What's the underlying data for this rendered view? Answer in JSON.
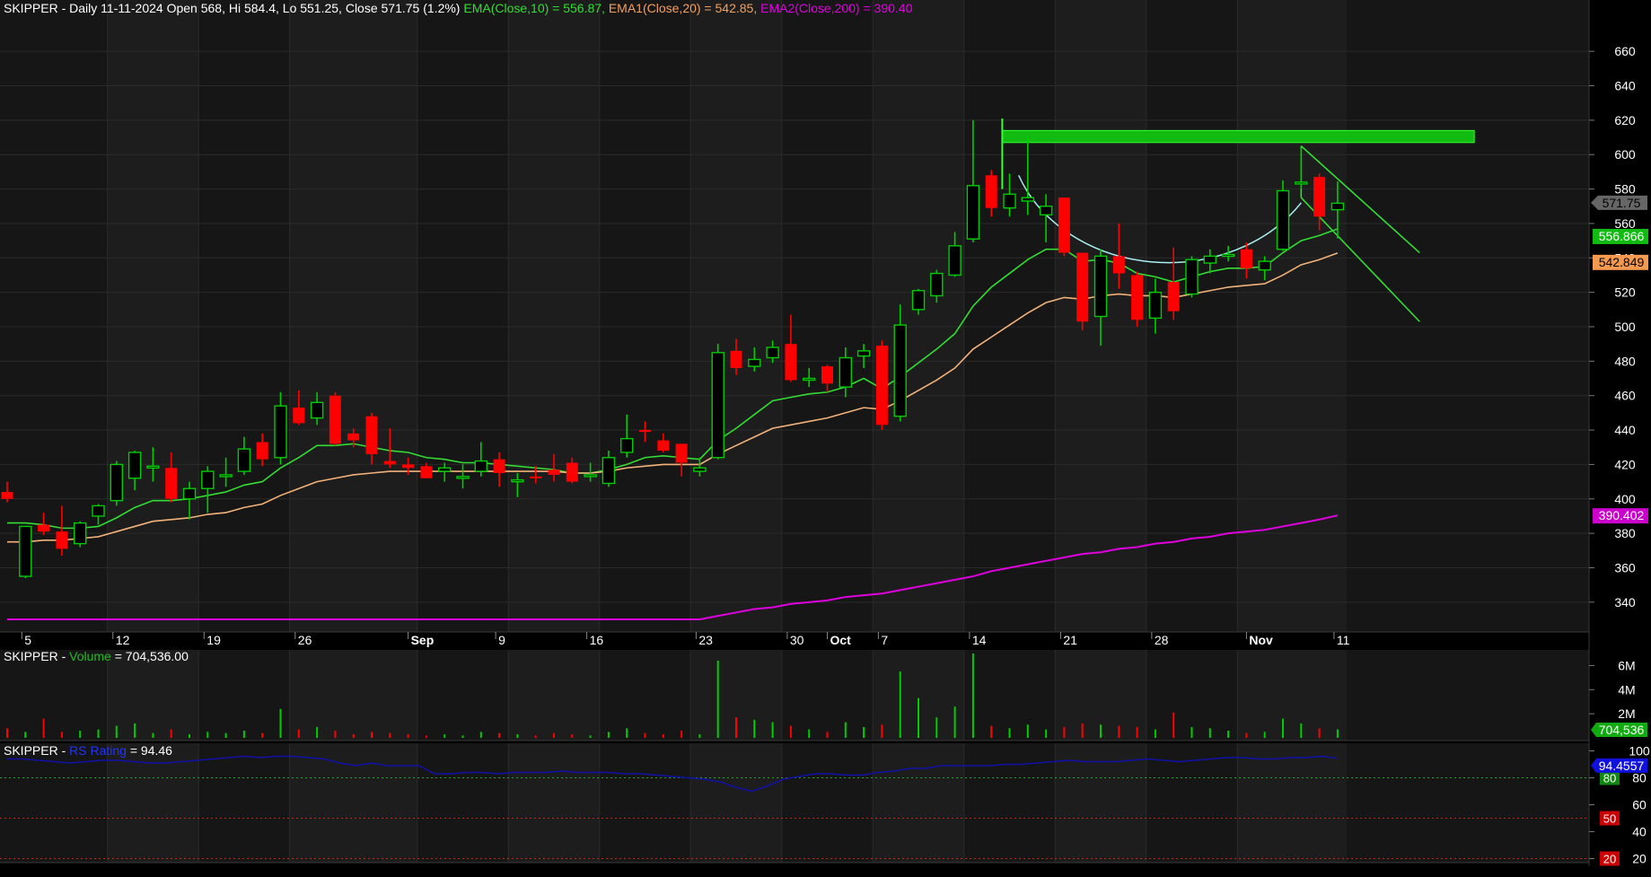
{
  "header": {
    "symbol": "SKIPPER",
    "text": "- Daily 11-11-2024 Open 568, Hi 584.4, Lo 551.25, Close 571.75 (1.2%)",
    "ema10_text": "EMA(Close,10) = 556.87,",
    "ema20_text": "EMA1(Close,20) = 542.85,",
    "ema200_text": "EMA2(Close,200) = 390.40"
  },
  "volume_header": {
    "symbol": "SKIPPER -",
    "label": "Volume",
    "value_text": "= 704,536.00"
  },
  "rs_header": {
    "symbol": "SKIPPER -",
    "label": "RS Rating",
    "value_text": "= 94.46"
  },
  "colors": {
    "background": "#000000",
    "panel": "#161616",
    "alt_band": "#1d1d1d",
    "grid": "#2b2b2b",
    "up": "#00cc00",
    "down": "#ff0000",
    "ema10": "#33dd33",
    "ema20": "#f3b27a",
    "ema200": "#e000e0",
    "rs_line": "#1111aa",
    "bowl": "#aaf0f0",
    "resistance": "#11bb11",
    "text": "#ffffff"
  },
  "chart_data": [
    {
      "type": "candlestick",
      "title": "SKIPPER - Daily 11-11-2024",
      "ylim": [
        330,
        670
      ],
      "yticks": [
        340,
        360,
        380,
        400,
        420,
        440,
        460,
        480,
        500,
        520,
        540,
        560,
        580,
        600,
        620,
        640,
        660
      ],
      "x_labels": [
        "5",
        "12",
        "19",
        "26",
        "Sep",
        "9",
        "16",
        "23",
        "30",
        "Oct",
        "7",
        "14",
        "21",
        "28",
        "Nov",
        "11"
      ],
      "grid": true,
      "candles": [
        {
          "o": 404,
          "h": 410,
          "l": 398,
          "c": 400
        },
        {
          "o": 355,
          "h": 384,
          "l": 354,
          "c": 384
        },
        {
          "o": 385,
          "h": 392,
          "l": 379,
          "c": 381
        },
        {
          "o": 381,
          "h": 396,
          "l": 367,
          "c": 371
        },
        {
          "o": 374,
          "h": 387,
          "l": 372,
          "c": 386
        },
        {
          "o": 390,
          "h": 397,
          "l": 385,
          "c": 396
        },
        {
          "o": 399,
          "h": 422,
          "l": 396,
          "c": 420
        },
        {
          "o": 412,
          "h": 428,
          "l": 405,
          "c": 427
        },
        {
          "o": 419,
          "h": 430,
          "l": 410,
          "c": 419
        },
        {
          "o": 418,
          "h": 427,
          "l": 398,
          "c": 400
        },
        {
          "o": 400,
          "h": 410,
          "l": 388,
          "c": 406
        },
        {
          "o": 406,
          "h": 419,
          "l": 392,
          "c": 416
        },
        {
          "o": 413,
          "h": 424,
          "l": 407,
          "c": 414
        },
        {
          "o": 416,
          "h": 436,
          "l": 414,
          "c": 429
        },
        {
          "o": 433,
          "h": 438,
          "l": 419,
          "c": 423
        },
        {
          "o": 424,
          "h": 462,
          "l": 420,
          "c": 454
        },
        {
          "o": 453,
          "h": 463,
          "l": 443,
          "c": 444
        },
        {
          "o": 447,
          "h": 462,
          "l": 443,
          "c": 456
        },
        {
          "o": 460,
          "h": 462,
          "l": 431,
          "c": 432
        },
        {
          "o": 438,
          "h": 441,
          "l": 430,
          "c": 434
        },
        {
          "o": 448,
          "h": 450,
          "l": 420,
          "c": 426
        },
        {
          "o": 422,
          "h": 441,
          "l": 418,
          "c": 420
        },
        {
          "o": 420,
          "h": 424,
          "l": 414,
          "c": 418
        },
        {
          "o": 419,
          "h": 421,
          "l": 412,
          "c": 412
        },
        {
          "o": 416,
          "h": 421,
          "l": 410,
          "c": 418
        },
        {
          "o": 412,
          "h": 420,
          "l": 406,
          "c": 413
        },
        {
          "o": 416,
          "h": 433,
          "l": 413,
          "c": 422
        },
        {
          "o": 423,
          "h": 427,
          "l": 407,
          "c": 415
        },
        {
          "o": 410,
          "h": 415,
          "l": 401,
          "c": 411
        },
        {
          "o": 413,
          "h": 419,
          "l": 409,
          "c": 412
        },
        {
          "o": 417,
          "h": 426,
          "l": 410,
          "c": 414
        },
        {
          "o": 421,
          "h": 424,
          "l": 409,
          "c": 410
        },
        {
          "o": 414,
          "h": 421,
          "l": 410,
          "c": 414
        },
        {
          "o": 409,
          "h": 428,
          "l": 407,
          "c": 424
        },
        {
          "o": 427,
          "h": 449,
          "l": 424,
          "c": 435
        },
        {
          "o": 440,
          "h": 445,
          "l": 433,
          "c": 439
        },
        {
          "o": 434,
          "h": 438,
          "l": 427,
          "c": 428
        },
        {
          "o": 432,
          "h": 432,
          "l": 413,
          "c": 421
        },
        {
          "o": 416,
          "h": 424,
          "l": 413,
          "c": 418
        },
        {
          "o": 424,
          "h": 490,
          "l": 423,
          "c": 485
        },
        {
          "o": 486,
          "h": 493,
          "l": 472,
          "c": 476
        },
        {
          "o": 477,
          "h": 488,
          "l": 474,
          "c": 481
        },
        {
          "o": 482,
          "h": 492,
          "l": 479,
          "c": 488
        },
        {
          "o": 490,
          "h": 507,
          "l": 468,
          "c": 469
        },
        {
          "o": 469,
          "h": 476,
          "l": 465,
          "c": 470
        },
        {
          "o": 477,
          "h": 478,
          "l": 462,
          "c": 467
        },
        {
          "o": 465,
          "h": 488,
          "l": 459,
          "c": 482
        },
        {
          "o": 483,
          "h": 490,
          "l": 476,
          "c": 486
        },
        {
          "o": 489,
          "h": 492,
          "l": 440,
          "c": 443
        },
        {
          "o": 448,
          "h": 513,
          "l": 445,
          "c": 501
        },
        {
          "o": 510,
          "h": 522,
          "l": 507,
          "c": 521
        },
        {
          "o": 518,
          "h": 533,
          "l": 514,
          "c": 531
        },
        {
          "o": 530,
          "h": 555,
          "l": 529,
          "c": 547
        },
        {
          "o": 551,
          "h": 620,
          "l": 549,
          "c": 582
        },
        {
          "o": 588,
          "h": 591,
          "l": 564,
          "c": 569
        },
        {
          "o": 569,
          "h": 589,
          "l": 564,
          "c": 577
        },
        {
          "o": 573,
          "h": 611,
          "l": 565,
          "c": 575
        },
        {
          "o": 565,
          "h": 577,
          "l": 549,
          "c": 570
        },
        {
          "o": 575,
          "h": 575,
          "l": 541,
          "c": 543
        },
        {
          "o": 543,
          "h": 543,
          "l": 498,
          "c": 503
        },
        {
          "o": 506,
          "h": 545,
          "l": 489,
          "c": 541
        },
        {
          "o": 541,
          "h": 560,
          "l": 522,
          "c": 531
        },
        {
          "o": 530,
          "h": 532,
          "l": 500,
          "c": 504
        },
        {
          "o": 505,
          "h": 528,
          "l": 496,
          "c": 520
        },
        {
          "o": 526,
          "h": 546,
          "l": 504,
          "c": 509
        },
        {
          "o": 519,
          "h": 541,
          "l": 517,
          "c": 539
        },
        {
          "o": 537,
          "h": 545,
          "l": 531,
          "c": 541
        },
        {
          "o": 542,
          "h": 547,
          "l": 538,
          "c": 542
        },
        {
          "o": 545,
          "h": 549,
          "l": 528,
          "c": 534
        },
        {
          "o": 533,
          "h": 541,
          "l": 527,
          "c": 538
        },
        {
          "o": 545,
          "h": 585,
          "l": 544,
          "c": 579
        },
        {
          "o": 583,
          "h": 604,
          "l": 580,
          "c": 584
        },
        {
          "o": 587,
          "h": 589,
          "l": 556,
          "c": 564
        },
        {
          "o": 568,
          "h": 584.4,
          "l": 551.25,
          "c": 571.75
        }
      ],
      "series": [
        {
          "name": "EMA(Close,10)",
          "values": [
            386,
            386,
            385,
            383,
            383,
            384,
            389,
            395,
            399,
            399,
            400,
            402,
            404,
            408,
            410,
            418,
            424,
            431,
            431,
            432,
            430,
            428,
            427,
            424,
            423,
            421,
            421,
            420,
            419,
            418,
            417,
            415,
            415,
            417,
            420,
            424,
            425,
            424,
            423,
            434,
            441,
            449,
            457,
            459,
            461,
            462,
            465,
            470,
            464,
            471,
            479,
            487,
            496,
            512,
            523,
            531,
            539,
            545,
            545,
            538,
            539,
            537,
            531,
            529,
            526,
            529,
            532,
            534,
            534,
            535,
            543,
            550,
            553,
            556.87
          ]
        },
        {
          "name": "EMA1(Close,20)",
          "values": [
            375,
            375,
            376,
            376,
            377,
            378,
            381,
            384,
            387,
            388,
            389,
            391,
            392,
            395,
            397,
            402,
            406,
            410,
            412,
            414,
            415,
            416,
            416,
            416,
            416,
            416,
            416,
            416,
            416,
            416,
            416,
            415,
            415,
            416,
            418,
            419,
            420,
            420,
            420,
            426,
            431,
            436,
            441,
            443,
            445,
            447,
            450,
            453,
            452,
            457,
            463,
            469,
            476,
            487,
            494,
            501,
            508,
            514,
            517,
            516,
            518,
            519,
            518,
            518,
            517,
            519,
            521,
            523,
            524,
            525,
            530,
            536,
            539,
            542.85
          ]
        },
        {
          "name": "EMA2(Close,200)",
          "values": [
            330,
            330,
            330,
            330,
            330,
            330,
            330,
            330,
            330,
            330,
            330,
            330,
            330,
            330,
            330,
            330,
            330,
            330,
            330,
            330,
            330,
            330,
            330,
            330,
            330,
            330,
            330,
            330,
            330,
            330,
            330,
            330,
            330,
            330,
            330,
            330,
            330,
            330,
            330,
            332,
            334,
            336,
            337,
            339,
            340,
            341,
            343,
            344,
            345,
            347,
            349,
            351,
            353,
            355,
            358,
            360,
            362,
            364,
            366,
            368,
            369,
            371,
            372,
            374,
            375,
            377,
            378,
            380,
            381,
            382,
            384,
            386,
            388,
            390.4
          ]
        }
      ],
      "price_tags": [
        {
          "text": "571.75"
        },
        {
          "text": "556.866"
        },
        {
          "text": "542.849"
        },
        {
          "text": "390.402"
        }
      ]
    },
    {
      "type": "bar",
      "title": "Volume",
      "ylim": [
        0,
        7000000
      ],
      "yticks": [
        2000000,
        4000000,
        6000000
      ],
      "ytick_labels": [
        "2M",
        "4M",
        "6M"
      ],
      "values": [
        800000,
        500000,
        1600000,
        500000,
        600000,
        700000,
        1000000,
        1200000,
        400000,
        700000,
        300000,
        500000,
        400000,
        600000,
        400000,
        2400000,
        700000,
        900000,
        600000,
        300000,
        500000,
        400000,
        300000,
        200000,
        300000,
        200000,
        500000,
        400000,
        300000,
        200000,
        400000,
        300000,
        200000,
        500000,
        800000,
        400000,
        300000,
        600000,
        300000,
        6400000,
        1700000,
        1500000,
        1300000,
        1000000,
        700000,
        500000,
        1300000,
        900000,
        1100000,
        5500000,
        3300000,
        1700000,
        2600000,
        7000000,
        1000000,
        800000,
        1100000,
        700000,
        900000,
        1200000,
        1100000,
        1000000,
        900000,
        700000,
        2100000,
        900000,
        800000,
        600000,
        400000,
        500000,
        1600000,
        1200000,
        800000,
        704536
      ],
      "value_tag": "704,536"
    },
    {
      "type": "line",
      "title": "RS Rating",
      "ylim": [
        15,
        105
      ],
      "yticks": [
        20,
        40,
        60,
        80,
        100
      ],
      "reference_lines": [
        {
          "tag": "80"
        },
        {
          "tag": "50"
        },
        {
          "tag": "20"
        }
      ],
      "series": [
        {
          "name": "RS Rating",
          "values": [
            94,
            94,
            93,
            92,
            91,
            92,
            93,
            93,
            92,
            91,
            91,
            92,
            93,
            94,
            95,
            96,
            95,
            96,
            96,
            95,
            94,
            91,
            89,
            91,
            89,
            89,
            89,
            83,
            83,
            84,
            84,
            83,
            84,
            84,
            84,
            85,
            84,
            84,
            84,
            83,
            83,
            82,
            81,
            80,
            79,
            77,
            73,
            70,
            74,
            79,
            81,
            83,
            83,
            82,
            82,
            84,
            85,
            87,
            87,
            89,
            89,
            89,
            89,
            90,
            90,
            91,
            92,
            93,
            92,
            92,
            92,
            93,
            94,
            93,
            92,
            93,
            94,
            95,
            95,
            94,
            94,
            95,
            95,
            96,
            94.46
          ]
        }
      ],
      "value_tag": "94.4557"
    }
  ]
}
